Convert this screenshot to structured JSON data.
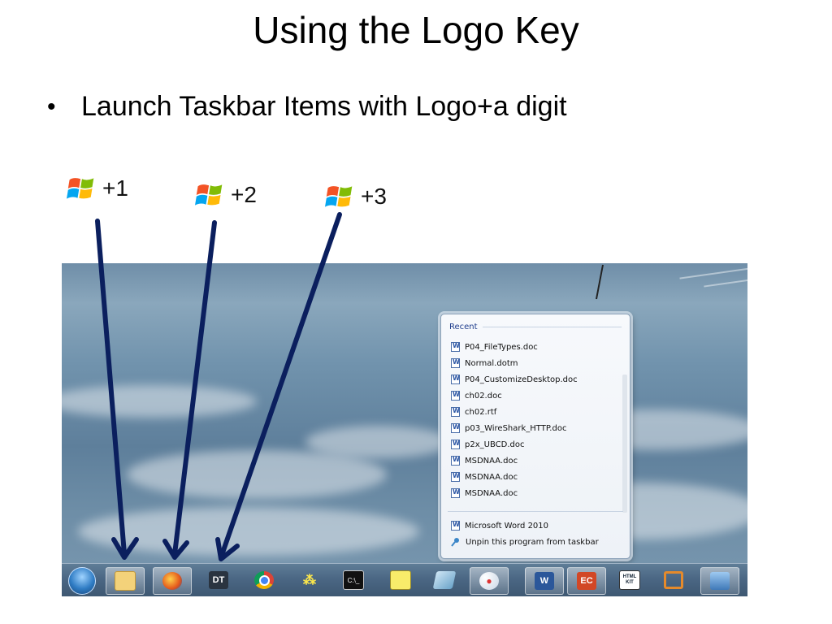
{
  "slide": {
    "title": "Using the Logo Key",
    "bullet": "Launch Taskbar Items with Logo+a digit"
  },
  "shortcuts": [
    {
      "label": "+1"
    },
    {
      "label": "+2"
    },
    {
      "label": "+3"
    }
  ],
  "jumplist": {
    "header": "Recent",
    "recent": [
      "P04_FileTypes.doc",
      "Normal.dotm",
      "P04_CustomizeDesktop.doc",
      "ch02.doc",
      "ch02.rtf",
      "p03_WireShark_HTTP.doc",
      "p2x_UBCD.doc",
      "MSDNAA.doc",
      "MSDNAA.doc",
      "MSDNAA.doc"
    ],
    "program": "Microsoft Word 2010",
    "unpin": "Unpin this program from taskbar"
  },
  "taskbar": {
    "items": [
      {
        "name": "explorer-icon",
        "label": ""
      },
      {
        "name": "firefox-icon",
        "label": ""
      },
      {
        "name": "dt-app-icon",
        "label": "DT"
      },
      {
        "name": "chrome-icon",
        "label": ""
      },
      {
        "name": "dots-app-icon",
        "label": ""
      },
      {
        "name": "cmd-icon",
        "label": "C:\\_"
      },
      {
        "name": "notes-icon",
        "label": ""
      },
      {
        "name": "book-icon",
        "label": ""
      },
      {
        "name": "paint-icon",
        "label": ""
      },
      {
        "name": "word-icon",
        "label": "W"
      },
      {
        "name": "powerpoint-icon",
        "label": "EC"
      },
      {
        "name": "html-kit-icon",
        "label": "HTML KIT"
      },
      {
        "name": "vmware-icon",
        "label": ""
      },
      {
        "name": "network-icon",
        "label": ""
      }
    ]
  },
  "colors": {
    "arrow": "#0b1f5e",
    "jumplist_header": "#1e3c8c"
  }
}
